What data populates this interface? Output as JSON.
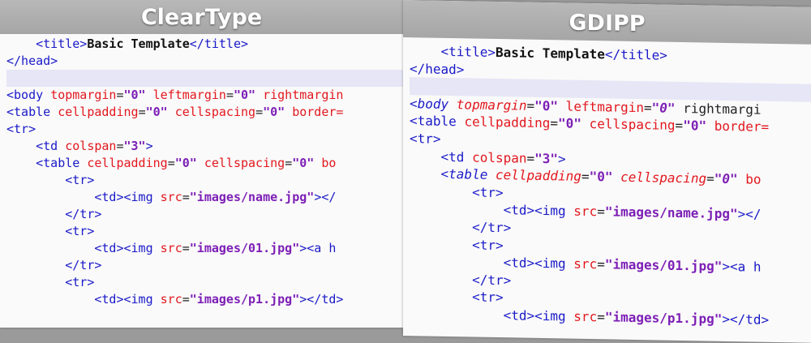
{
  "panels": [
    {
      "title": "ClearType",
      "lines": [
        {
          "indent": 4,
          "tokens": [
            {
              "t": "tag",
              "v": "<title>"
            },
            {
              "t": "txt",
              "v": "Basic Template"
            },
            {
              "t": "tag",
              "v": "</title>"
            }
          ]
        },
        {
          "indent": 0,
          "tokens": [
            {
              "t": "tag",
              "v": "</head>"
            }
          ]
        },
        {
          "indent": 0,
          "highlight": true,
          "tokens": []
        },
        {
          "indent": 0,
          "tokens": [
            {
              "t": "tag",
              "v": "<body "
            },
            {
              "t": "attr",
              "v": "topmargin"
            },
            {
              "t": "eq",
              "v": "="
            },
            {
              "t": "val",
              "v": "\"0\""
            },
            {
              "t": "attr",
              "v": " leftmargin"
            },
            {
              "t": "eq",
              "v": "="
            },
            {
              "t": "val",
              "v": "\"0\""
            },
            {
              "t": "attr",
              "v": " rightmargin"
            }
          ]
        },
        {
          "indent": 0,
          "tokens": [
            {
              "t": "tag",
              "v": "<table "
            },
            {
              "t": "attr",
              "v": "cellpadding"
            },
            {
              "t": "eq",
              "v": "="
            },
            {
              "t": "val",
              "v": "\"0\""
            },
            {
              "t": "attr",
              "v": " cellspacing"
            },
            {
              "t": "eq",
              "v": "="
            },
            {
              "t": "val",
              "v": "\"0\""
            },
            {
              "t": "attr",
              "v": " border="
            }
          ]
        },
        {
          "indent": 0,
          "tokens": [
            {
              "t": "tag",
              "v": "<tr>"
            }
          ]
        },
        {
          "indent": 4,
          "tokens": [
            {
              "t": "tag",
              "v": "<td "
            },
            {
              "t": "attr",
              "v": "colspan"
            },
            {
              "t": "eq",
              "v": "="
            },
            {
              "t": "val",
              "v": "\"3\""
            },
            {
              "t": "tag",
              "v": ">"
            }
          ]
        },
        {
          "indent": 4,
          "tokens": [
            {
              "t": "tag",
              "v": "<table "
            },
            {
              "t": "attr",
              "v": "cellpadding"
            },
            {
              "t": "eq",
              "v": "="
            },
            {
              "t": "val",
              "v": "\"0\""
            },
            {
              "t": "attr",
              "v": " cellspacing"
            },
            {
              "t": "eq",
              "v": "="
            },
            {
              "t": "val",
              "v": "\"0\""
            },
            {
              "t": "attr",
              "v": " bo"
            }
          ]
        },
        {
          "indent": 8,
          "tokens": [
            {
              "t": "tag",
              "v": "<tr>"
            }
          ]
        },
        {
          "indent": 12,
          "tokens": [
            {
              "t": "tag",
              "v": "<td><img "
            },
            {
              "t": "attr",
              "v": "src"
            },
            {
              "t": "eq",
              "v": "="
            },
            {
              "t": "val",
              "v": "\"images/name.jpg\""
            },
            {
              "t": "tag",
              "v": "></"
            }
          ]
        },
        {
          "indent": 8,
          "tokens": [
            {
              "t": "tag",
              "v": "</tr>"
            }
          ]
        },
        {
          "indent": 8,
          "tokens": [
            {
              "t": "tag",
              "v": "<tr>"
            }
          ]
        },
        {
          "indent": 12,
          "tokens": [
            {
              "t": "tag",
              "v": "<td><img "
            },
            {
              "t": "attr",
              "v": "src"
            },
            {
              "t": "eq",
              "v": "="
            },
            {
              "t": "val",
              "v": "\"images/01.jpg\""
            },
            {
              "t": "tag",
              "v": "><a h"
            }
          ]
        },
        {
          "indent": 8,
          "tokens": [
            {
              "t": "tag",
              "v": "</tr>"
            }
          ]
        },
        {
          "indent": 8,
          "tokens": [
            {
              "t": "tag",
              "v": "<tr>"
            }
          ]
        },
        {
          "indent": 12,
          "tokens": [
            {
              "t": "tag",
              "v": "<td><img "
            },
            {
              "t": "attr",
              "v": "src"
            },
            {
              "t": "eq",
              "v": "="
            },
            {
              "t": "val",
              "v": "\"images/p1.jpg\""
            },
            {
              "t": "tag",
              "v": "></td>"
            }
          ]
        }
      ]
    },
    {
      "title": "GDIPP",
      "lines": [
        {
          "indent": 4,
          "tokens": [
            {
              "t": "tag",
              "v": "<title>"
            },
            {
              "t": "txt",
              "v": "Basic Template"
            },
            {
              "t": "tag",
              "v": "</title>"
            }
          ]
        },
        {
          "indent": 0,
          "tokens": [
            {
              "t": "tag",
              "v": "</head>"
            }
          ]
        },
        {
          "indent": 0,
          "highlight": true,
          "tokens": []
        },
        {
          "indent": 0,
          "tokens": [
            {
              "t": "tag it",
              "v": "<body "
            },
            {
              "t": "attr it",
              "v": "topmargin"
            },
            {
              "t": "eq",
              "v": "="
            },
            {
              "t": "val",
              "v": "\"0\""
            },
            {
              "t": "attr",
              "v": " leftmargin"
            },
            {
              "t": "eq",
              "v": "="
            },
            {
              "t": "val it",
              "v": "\"0\""
            },
            {
              "t": "eq",
              "v": " rightmargi"
            }
          ]
        },
        {
          "indent": 0,
          "tokens": [
            {
              "t": "tag",
              "v": "<table "
            },
            {
              "t": "attr",
              "v": "cellpadding"
            },
            {
              "t": "eq",
              "v": "="
            },
            {
              "t": "val",
              "v": "\"0\""
            },
            {
              "t": "attr",
              "v": " cellspacing"
            },
            {
              "t": "eq",
              "v": "="
            },
            {
              "t": "val",
              "v": "\"0\""
            },
            {
              "t": "attr",
              "v": " border="
            }
          ]
        },
        {
          "indent": 0,
          "tokens": [
            {
              "t": "tag",
              "v": "<tr>"
            }
          ]
        },
        {
          "indent": 4,
          "tokens": [
            {
              "t": "tag",
              "v": "<td "
            },
            {
              "t": "attr",
              "v": "colspan"
            },
            {
              "t": "eq",
              "v": "="
            },
            {
              "t": "val",
              "v": "\"3\""
            },
            {
              "t": "tag",
              "v": ">"
            }
          ]
        },
        {
          "indent": 4,
          "tokens": [
            {
              "t": "tag it",
              "v": "<table "
            },
            {
              "t": "attr it",
              "v": "cellpadding"
            },
            {
              "t": "eq",
              "v": "="
            },
            {
              "t": "val",
              "v": "\"0\""
            },
            {
              "t": "attr it",
              "v": " cellspacing"
            },
            {
              "t": "eq",
              "v": "="
            },
            {
              "t": "val it",
              "v": "\"0\""
            },
            {
              "t": "attr",
              "v": " bo"
            }
          ]
        },
        {
          "indent": 8,
          "tokens": [
            {
              "t": "tag",
              "v": "<tr>"
            }
          ]
        },
        {
          "indent": 12,
          "tokens": [
            {
              "t": "tag",
              "v": "<td><img "
            },
            {
              "t": "attr",
              "v": "src"
            },
            {
              "t": "eq",
              "v": "="
            },
            {
              "t": "val",
              "v": "\"images/name.jpg\""
            },
            {
              "t": "tag",
              "v": "></"
            }
          ]
        },
        {
          "indent": 8,
          "tokens": [
            {
              "t": "tag",
              "v": "</tr>"
            }
          ]
        },
        {
          "indent": 8,
          "tokens": [
            {
              "t": "tag",
              "v": "<tr>"
            }
          ]
        },
        {
          "indent": 12,
          "tokens": [
            {
              "t": "tag",
              "v": "<td><img "
            },
            {
              "t": "attr",
              "v": "src"
            },
            {
              "t": "eq",
              "v": "="
            },
            {
              "t": "val",
              "v": "\"images/01.jpg\""
            },
            {
              "t": "tag",
              "v": "><a h"
            }
          ]
        },
        {
          "indent": 8,
          "tokens": [
            {
              "t": "tag",
              "v": "</tr>"
            }
          ]
        },
        {
          "indent": 8,
          "tokens": [
            {
              "t": "tag",
              "v": "<tr>"
            }
          ]
        },
        {
          "indent": 12,
          "tokens": [
            {
              "t": "tag",
              "v": "<td><img "
            },
            {
              "t": "attr",
              "v": "src"
            },
            {
              "t": "eq",
              "v": "="
            },
            {
              "t": "val",
              "v": "\"images/p1.jpg\""
            },
            {
              "t": "tag",
              "v": "></td>"
            }
          ]
        }
      ]
    }
  ]
}
